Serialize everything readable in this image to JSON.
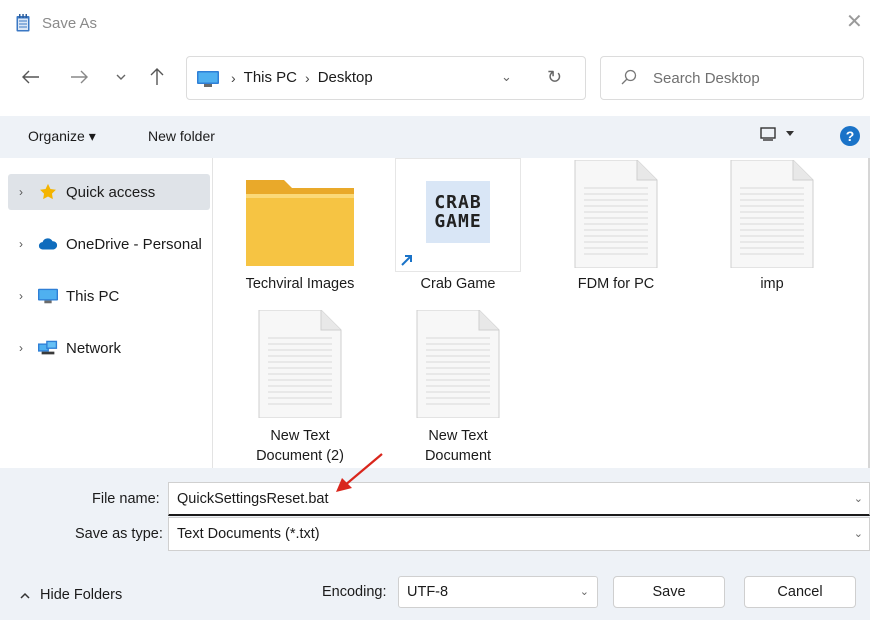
{
  "window": {
    "title": "Save As",
    "close_glyph": "✕"
  },
  "nav": {
    "back_icon": "arrow-left-icon",
    "forward_icon": "arrow-right-icon",
    "recent_icon": "chevron-down-icon",
    "up_icon": "arrow-up-icon",
    "breadcrumbs": [
      "This PC",
      "Desktop"
    ],
    "search_placeholder": "Search Desktop"
  },
  "toolbar": {
    "organize_label": "Organize ▾",
    "new_folder_label": "New folder",
    "help_glyph": "?"
  },
  "sidebar": {
    "items": [
      {
        "label": "Quick access",
        "icon": "star-icon",
        "active": true
      },
      {
        "label": "OneDrive - Personal",
        "icon": "cloud-icon",
        "active": false
      },
      {
        "label": "This PC",
        "icon": "monitor-icon",
        "active": false
      },
      {
        "label": "Network",
        "icon": "network-icon",
        "active": false
      }
    ]
  },
  "files": [
    {
      "name": "Techviral Images",
      "type": "folder"
    },
    {
      "name": "Crab Game",
      "type": "shortcut",
      "thumb_text_top": "CRAB",
      "thumb_text_bottom": "GAME"
    },
    {
      "name": "FDM for PC",
      "type": "document"
    },
    {
      "name": "imp",
      "type": "document"
    },
    {
      "name": "New Text Document (2)",
      "type": "document"
    },
    {
      "name": "New Text Document",
      "type": "document"
    }
  ],
  "form": {
    "file_name_label": "File name:",
    "file_name_value": "QuickSettingsReset.bat",
    "save_type_label": "Save as type:",
    "save_type_value": "Text Documents (*.txt)"
  },
  "footer": {
    "hide_folders_label": "Hide Folders",
    "encoding_label": "Encoding:",
    "encoding_value": "UTF-8",
    "save_label": "Save",
    "cancel_label": "Cancel"
  },
  "colors": {
    "accent": "#1a73c8",
    "folder": "#f6c443",
    "annotation_arrow": "#d9261c",
    "panel": "#eef2f7"
  }
}
